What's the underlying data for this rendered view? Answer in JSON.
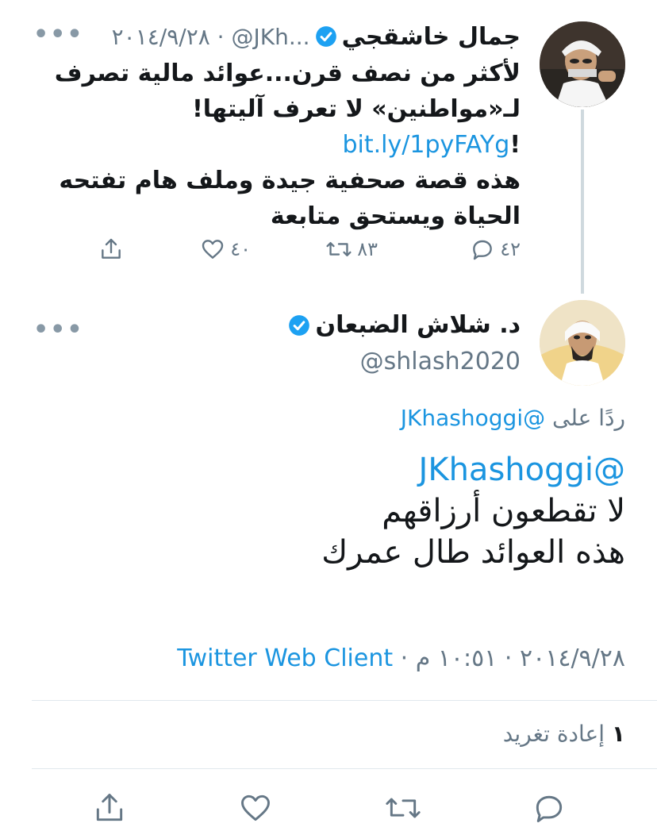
{
  "parent_tweet": {
    "name": "جمال خاشقجي",
    "handle_date": "٢٠١٤/٩/٢٨ · @JKh...",
    "lines": [
      "لأكثر من نصف قرن...عوائد مالية تصرف",
      "لـ«مواطنين» لا تعرف آليتها!",
      "!bit.ly/1pyFAYg",
      "هذه قصة صحفية جيدة وملف هام تفتحه",
      "الحياة ويستحق متابعة"
    ],
    "link_text": "bit.ly/1pyFAYg",
    "link_suffix": "!",
    "replies": "٤٢",
    "retweets": "٨٣",
    "likes": "٤٠"
  },
  "focused_tweet": {
    "name": "د. شلاش الضبعان",
    "handle": "@shlash2020",
    "replying_prefix": "ردًا على",
    "replying_to": "@JKhashoggi",
    "mention": "@JKhashoggi",
    "lines": [
      "لا تقطعون أرزاقهم",
      "هذه العوائد طال عمرك"
    ],
    "timestamp": "٢٠١٤/٩/٢٨ · ١٠:٥١ م · ",
    "client": "Twitter Web Client",
    "retweet_count": "١",
    "retweet_label": "إعادة تغريد"
  },
  "ui": {
    "more_label": "•••"
  },
  "icons": {
    "verified": "verified-badge-icon",
    "reply": "reply-icon",
    "retweet": "retweet-icon",
    "like": "like-icon",
    "share": "share-icon"
  },
  "colors": {
    "link": "#1b95e0",
    "secondary": "#657786",
    "text": "#14171a",
    "thread_line": "#cfd9de"
  }
}
